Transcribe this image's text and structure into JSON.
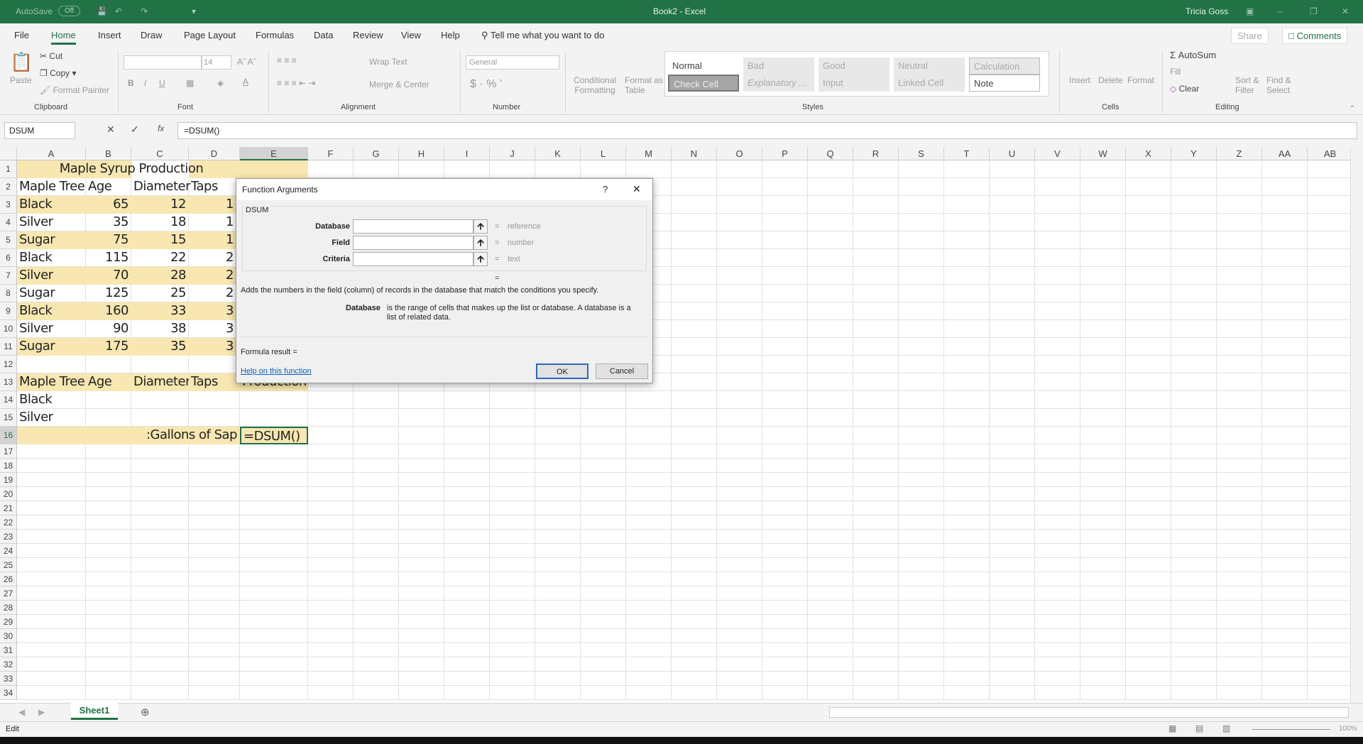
{
  "app": {
    "title": "Book2  -  Excel",
    "user": "Tricia Goss",
    "autosave_label": "AutoSave",
    "autosave_state": "Off",
    "accent": "#217346"
  },
  "tabs": [
    "File",
    "Home",
    "Insert",
    "Draw",
    "Page Layout",
    "Formulas",
    "Data",
    "Review",
    "View",
    "Help"
  ],
  "active_tab": "Home",
  "tell_me": "Tell me what you want to do",
  "share": "Share",
  "comments": "Comments",
  "ribbon": {
    "clipboard": {
      "paste": "Paste",
      "cut": "Cut",
      "copy": "Copy",
      "format_painter": "Format Painter",
      "label": "Clipboard"
    },
    "font": {
      "size": "14",
      "label": "Font"
    },
    "alignment": {
      "wrap": "Wrap Text",
      "merge": "Merge & Center",
      "label": "Alignment"
    },
    "number": {
      "format": "General",
      "label": "Number"
    },
    "styles": {
      "conditional": "Conditional",
      "conditional2": "Formatting",
      "format_table": "Format as",
      "format_table2": "Table",
      "items": [
        "Normal",
        "Bad",
        "Good",
        "Neutral",
        "Calculation",
        "Check Cell",
        "Explanatory ...",
        "Input",
        "Linked Cell",
        "Note"
      ],
      "label": "Styles"
    },
    "cells": {
      "insert": "Insert",
      "delete": "Delete",
      "format": "Format",
      "label": "Cells"
    },
    "editing": {
      "autosum": "AutoSum",
      "fill": "Fill",
      "clear": "Clear",
      "sort": "Sort &",
      "sort2": "Filter",
      "find": "Find &",
      "find2": "Select",
      "label": "Editing"
    }
  },
  "formula_bar": {
    "name_box": "DSUM",
    "formula": "=DSUM()"
  },
  "columns": [
    "A",
    "B",
    "C",
    "D",
    "E",
    "F",
    "G",
    "H",
    "I",
    "J",
    "K",
    "L",
    "M",
    "N",
    "O",
    "P",
    "Q",
    "R",
    "S",
    "T",
    "U",
    "V",
    "W",
    "X",
    "Y",
    "Z",
    "AA",
    "AB"
  ],
  "rows": [
    [
      "",
      "",
      "Maple Syrup Production",
      "",
      ""
    ],
    [
      "Maple Tree",
      "Age",
      "Diameter",
      "Taps",
      ""
    ],
    [
      "Black",
      "65",
      "12",
      "1",
      ""
    ],
    [
      "Silver",
      "35",
      "18",
      "1",
      ""
    ],
    [
      "Sugar",
      "75",
      "15",
      "1",
      ""
    ],
    [
      "Black",
      "115",
      "22",
      "2",
      ""
    ],
    [
      "Silver",
      "70",
      "28",
      "2",
      ""
    ],
    [
      "Sugar",
      "125",
      "25",
      "2",
      ""
    ],
    [
      "Black",
      "160",
      "33",
      "3",
      ""
    ],
    [
      "Silver",
      "90",
      "38",
      "3",
      ""
    ],
    [
      "Sugar",
      "175",
      "35",
      "3",
      ""
    ],
    [
      "",
      "",
      "",
      "",
      ""
    ],
    [
      "Maple Tree",
      "Age",
      "Diameter",
      "Taps",
      "Production"
    ],
    [
      "Black",
      "",
      "",
      "",
      ""
    ],
    [
      "Silver",
      "",
      "",
      "",
      ""
    ],
    [
      "",
      "",
      "",
      "Gallons of Sap:",
      "=DSUM()"
    ]
  ],
  "fill_color": "#f8e7b1",
  "dialog": {
    "title": "Function Arguments",
    "help": "?",
    "function": "DSUM",
    "args": [
      {
        "label": "Database",
        "hint": "reference"
      },
      {
        "label": "Field",
        "hint": "number"
      },
      {
        "label": "Criteria",
        "hint": "text"
      }
    ],
    "equals": "=",
    "description": "Adds the numbers in the field (column) of records in the database that match the conditions you specify.",
    "arg_name": "Database",
    "arg_desc": "is the range of cells that makes up the list or database. A database is a list of related data.",
    "result": "Formula result =",
    "help_link": "Help on this function",
    "ok": "OK",
    "cancel": "Cancel"
  },
  "sheet_tab": "Sheet1",
  "status": {
    "mode": "Edit",
    "zoom": "100%"
  }
}
